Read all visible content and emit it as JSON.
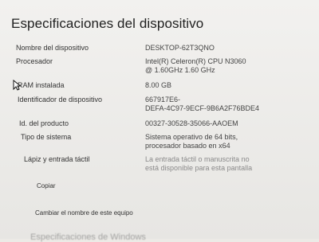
{
  "page": {
    "title": "Especificaciones del dispositivo"
  },
  "specs": [
    {
      "label": "Nombre del dispositivo",
      "value": [
        "DESKTOP-62T3QNO"
      ]
    },
    {
      "label": "Procesador",
      "value": [
        "Intel(R) Celeron(R) CPU  N3060",
        "@ 1.60GHz   1.60 GHz"
      ]
    },
    {
      "label": "RAM instalada",
      "value": [
        "8.00 GB"
      ]
    },
    {
      "label": "Identificador de dispositivo",
      "value": [
        "667917E6-",
        "DEFA-4C97-9ECF-9B6A2F76BDE4"
      ]
    },
    {
      "label": "Id. del producto",
      "value": [
        "00327-30528-35066-AAOEM"
      ]
    },
    {
      "label": "Tipo de sistema",
      "value": [
        "Sistema operativo de 64 bits,",
        "procesador basado en x64"
      ]
    },
    {
      "label": "Lápiz y entrada táctil",
      "value": [
        "La entrada táctil o manuscrita no",
        "está disponible para esta pantalla"
      ]
    }
  ],
  "actions": {
    "copy_label": "Copiar",
    "rename_label": "Cambiar el nombre de este equipo"
  },
  "next_section_partial": "Especificaciones de Windows"
}
